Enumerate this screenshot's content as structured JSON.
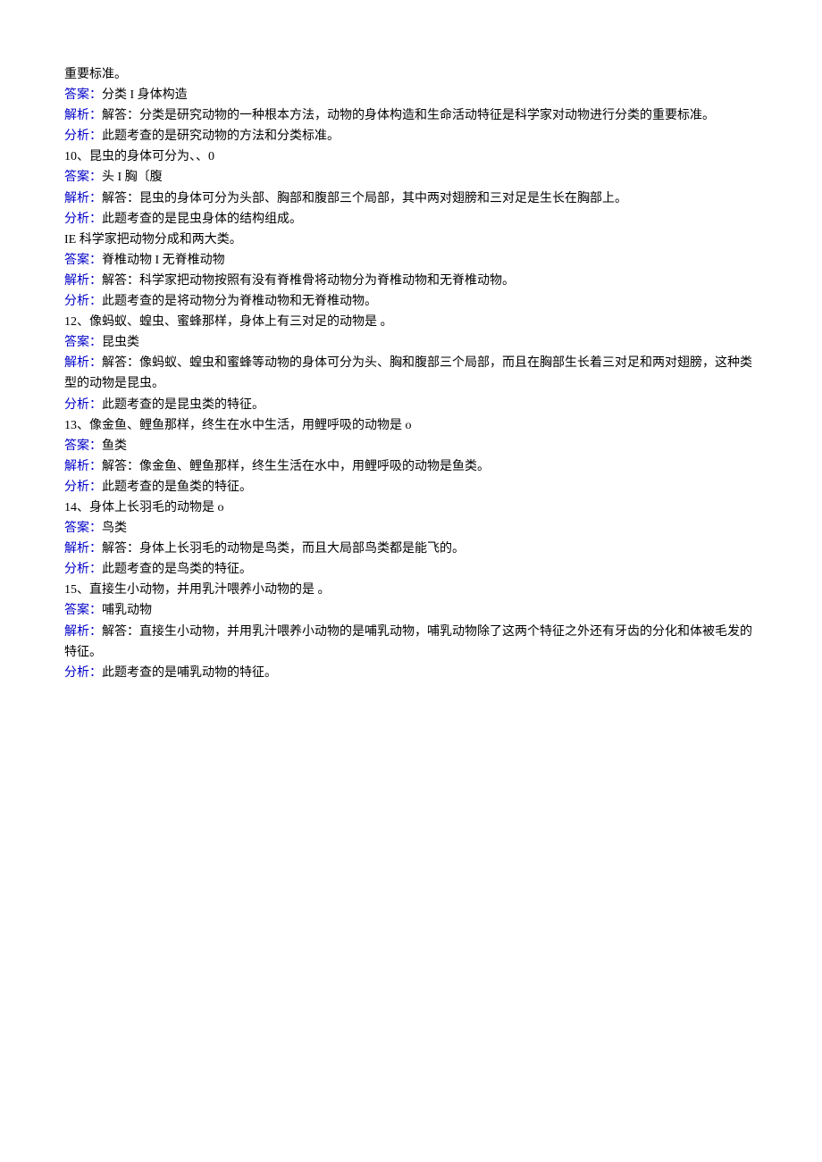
{
  "lines": [
    {
      "segments": [
        {
          "cls": "black",
          "text": "重要标准。"
        }
      ]
    },
    {
      "segments": [
        {
          "cls": "blue",
          "text": "答案："
        },
        {
          "cls": "black",
          "text": "分类 I 身体构造"
        }
      ]
    },
    {
      "segments": [
        {
          "cls": "blue",
          "text": "解析："
        },
        {
          "cls": "black",
          "text": "解答：分类是研究动物的一种根本方法，动物的身体构造和生命活动特征是科学家对动物进行分类的重要标准。"
        }
      ]
    },
    {
      "segments": [
        {
          "cls": "blue",
          "text": "分析："
        },
        {
          "cls": "black",
          "text": "此题考查的是研究动物的方法和分类标准。"
        }
      ]
    },
    {
      "segments": [
        {
          "cls": "black",
          "text": "10、昆虫的身体可分为、、0"
        }
      ]
    },
    {
      "segments": [
        {
          "cls": "blue",
          "text": "答案："
        },
        {
          "cls": "black",
          "text": "头 I 胸〔腹"
        }
      ]
    },
    {
      "segments": [
        {
          "cls": "blue",
          "text": "解析："
        },
        {
          "cls": "black",
          "text": "解答：昆虫的身体可分为头部、胸部和腹部三个局部，其中两对翅膀和三对足是生长在胸部上。"
        }
      ]
    },
    {
      "segments": [
        {
          "cls": "blue",
          "text": "分析："
        },
        {
          "cls": "black",
          "text": "此题考查的是昆虫身体的结构组成。"
        }
      ]
    },
    {
      "segments": [
        {
          "cls": "black",
          "text": "IE 科学家把动物分成和两大类。"
        }
      ]
    },
    {
      "segments": [
        {
          "cls": "blue",
          "text": "答案："
        },
        {
          "cls": "black",
          "text": "脊椎动物 I 无脊椎动物"
        }
      ]
    },
    {
      "segments": [
        {
          "cls": "blue",
          "text": "解析："
        },
        {
          "cls": "black",
          "text": "解答：科学家把动物按照有没有脊椎骨将动物分为脊椎动物和无脊椎动物。"
        }
      ]
    },
    {
      "segments": [
        {
          "cls": "blue",
          "text": "分析："
        },
        {
          "cls": "black",
          "text": "此题考查的是将动物分为脊椎动物和无脊椎动物。"
        }
      ]
    },
    {
      "segments": [
        {
          "cls": "black",
          "text": "12、像蚂蚁、蝗虫、蜜蜂那样，身体上有三对足的动物是 。"
        }
      ]
    },
    {
      "segments": [
        {
          "cls": "blue",
          "text": "答案："
        },
        {
          "cls": "black",
          "text": "昆虫类"
        }
      ]
    },
    {
      "segments": [
        {
          "cls": "blue",
          "text": "解析："
        },
        {
          "cls": "black",
          "text": "解答：像蚂蚁、蝗虫和蜜蜂等动物的身体可分为头、胸和腹部三个局部，而且在胸部生长着三对足和两对翅膀，这种类型的动物是昆虫。"
        }
      ]
    },
    {
      "segments": [
        {
          "cls": "blue",
          "text": "分析："
        },
        {
          "cls": "black",
          "text": "此题考查的是昆虫类的特征。"
        }
      ]
    },
    {
      "segments": [
        {
          "cls": "black",
          "text": "13、像金鱼、鲤鱼那样，终生在水中生活，用鲤呼吸的动物是 o"
        }
      ]
    },
    {
      "segments": [
        {
          "cls": "blue",
          "text": "答案："
        },
        {
          "cls": "black",
          "text": "鱼类"
        }
      ]
    },
    {
      "segments": [
        {
          "cls": "blue",
          "text": "解析："
        },
        {
          "cls": "black",
          "text": "解答：像金鱼、鲤鱼那样，终生生活在水中，用鲤呼吸的动物是鱼类。"
        }
      ]
    },
    {
      "segments": [
        {
          "cls": "blue",
          "text": "分析："
        },
        {
          "cls": "black",
          "text": "此题考查的是鱼类的特征。"
        }
      ]
    },
    {
      "segments": [
        {
          "cls": "black",
          "text": "14、身体上长羽毛的动物是 o"
        }
      ]
    },
    {
      "segments": [
        {
          "cls": "blue",
          "text": "答案："
        },
        {
          "cls": "black",
          "text": "鸟类"
        }
      ]
    },
    {
      "segments": [
        {
          "cls": "blue",
          "text": "解析："
        },
        {
          "cls": "black",
          "text": "解答：身体上长羽毛的动物是鸟类，而且大局部鸟类都是能飞的。"
        }
      ]
    },
    {
      "segments": [
        {
          "cls": "blue",
          "text": "分析："
        },
        {
          "cls": "black",
          "text": "此题考查的是鸟类的特征。"
        }
      ]
    },
    {
      "segments": [
        {
          "cls": "black",
          "text": "15、直接生小动物，并用乳汁喂养小动物的是 。"
        }
      ]
    },
    {
      "segments": [
        {
          "cls": "blue",
          "text": "答案："
        },
        {
          "cls": "black",
          "text": "哺乳动物"
        }
      ]
    },
    {
      "segments": [
        {
          "cls": "blue",
          "text": "解析："
        },
        {
          "cls": "black",
          "text": "解答：直接生小动物，并用乳汁喂养小动物的是哺乳动物，哺乳动物除了这两个特征之外还有牙齿的分化和体被毛发的特征。"
        }
      ]
    },
    {
      "segments": [
        {
          "cls": "blue",
          "text": "分析："
        },
        {
          "cls": "black",
          "text": "此题考查的是哺乳动物的特征。"
        }
      ]
    }
  ]
}
